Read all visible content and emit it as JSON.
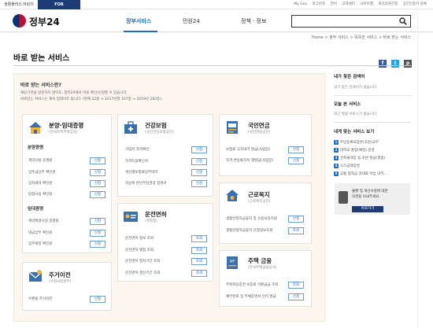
{
  "topbar": {
    "links": [
      "생활플러스",
      "어린이",
      "FOR FOREIGNER"
    ],
    "right_links": [
      "My Gov",
      "로그아웃",
      "언어",
      "고객센터",
      "사이트맵",
      "개선의견신청",
      "공인인증서 등록"
    ]
  },
  "header": {
    "logo_text": "정부24",
    "nav": [
      "정부서비스",
      "민원24",
      "정책 · 정보"
    ],
    "search_placeholder": ""
  },
  "breadcrumb": "Home > 정부 서비스 > 똑똑한 서비스 > 바로 받는 서비스",
  "page_title": "바로 받는 서비스",
  "share": [
    "f",
    "t",
    "p"
  ],
  "intro": {
    "title": "바로 받는 서비스란?",
    "line1": "해당기관을 방문하지 않아도, 정부24에서 바로 확인/신청할 수 있습니다.",
    "line2": "바로받는 서비스는 계속 업데이트 됩니다. (현재 22종 → 2017년말 107종 → 2019년 282종)"
  },
  "button_label": "신청",
  "button_label_alt": "조회",
  "cards": {
    "housing": {
      "title": "분양·임대증명",
      "subtitle": "(한국토지주택공사)",
      "sec1": "분양증명",
      "sec1_items": [
        "계약사실 증명원",
        "임주금납부 확인원",
        "임차세대 확인원",
        "당첨사실 확인원"
      ],
      "sec2": "임대증명",
      "sec2_items": [
        "계약체결사실 증명원",
        "대금납부 확인원",
        "임주예정 확인원"
      ]
    },
    "health": {
      "title": "건강보험",
      "subtitle": "(국민건강보험공단)",
      "items": [
        "가입자 자격확인",
        "자격득실확인서",
        "개인별보험료납부내역",
        "자상위 본인부담경감 증명서"
      ]
    },
    "pension": {
      "title": "국민연금",
      "subtitle": "(국민연금공단)",
      "items": [
        "보험료 고지내역 발급(사업장)",
        "자격 변동통지서 재발급(사업장)"
      ]
    },
    "welfare": {
      "title": "근로복지",
      "subtitle": "(근로복지공단)",
      "items": [
        "생활안정자금융자 및 신용보증지원",
        "생활안정자금융자 신청정보조회"
      ]
    },
    "driver": {
      "title": "운전면허",
      "subtitle": "(경찰청)",
      "items": [
        "운전면허 정보 조회",
        "운전면허 벌점 조회",
        "운전면허 정지기간 조회",
        "운전면허 갱신기간 조회"
      ]
    },
    "move": {
      "title": "주거이전",
      "subtitle": "(우정사업본부)",
      "items": [
        "우편물 주거이전"
      ]
    },
    "finance": {
      "title": "주택 금융",
      "subtitle": "(한국주택금융공사)",
      "items": [
        "주택저당증권 보증료 미환급금 조회",
        "채무완료 및 부채증명서 인터 발급"
      ]
    }
  },
  "sidebar": {
    "recent_title": "내가 찾은 검색어",
    "recent_empty": "내가 찾은 검색어가 없습니다.",
    "today_title": "오늘 본 서비스",
    "today_empty": "최근 열람 서비스가 없습니다.",
    "rec_title": "내게 맞는 서비스 보기",
    "rec_items": [
      "주민등록표등본(초본)교부",
      "대학교 졸업(예정) 증명",
      "건축물대장 등·초본 발급(열람)",
      "소득금액증명",
      "교통 범칙금 과태료 미납 내역…"
    ],
    "feedback_text1": "불편 및 개선사항에 대한",
    "feedback_text2": "의견을 보내주세요.",
    "feedback_button": "바로가기"
  }
}
